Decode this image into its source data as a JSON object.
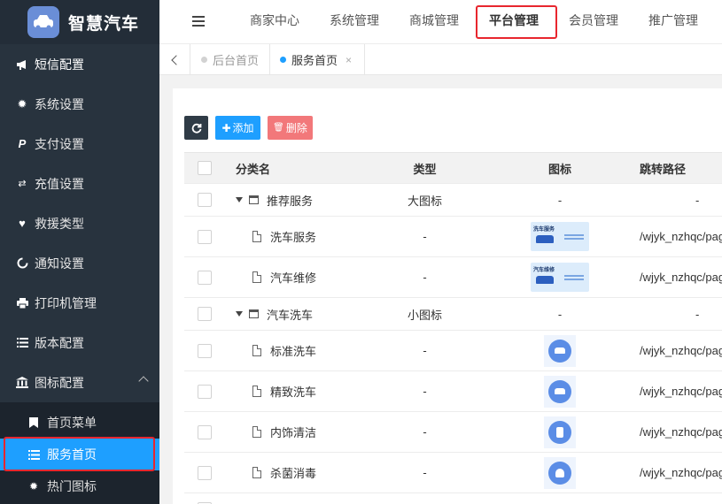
{
  "brand": {
    "title": "智慧汽车",
    "logo_icon": "car-icon"
  },
  "sidebar": {
    "items": [
      {
        "label": "短信配置",
        "icon": "megaphone-icon"
      },
      {
        "label": "系统设置",
        "icon": "gear-icon"
      },
      {
        "label": "支付设置",
        "icon": "paypal-icon"
      },
      {
        "label": "充值设置",
        "icon": "money-transfer-icon"
      },
      {
        "label": "救援类型",
        "icon": "heart-icon"
      },
      {
        "label": "通知设置",
        "icon": "circle-notch-icon"
      },
      {
        "label": "打印机管理",
        "icon": "printer-icon"
      },
      {
        "label": "版本配置",
        "icon": "list-icon"
      },
      {
        "label": "图标配置",
        "icon": "bank-icon",
        "expanded": true
      }
    ],
    "submenu": [
      {
        "label": "首页菜单",
        "icon": "bookmark-icon"
      },
      {
        "label": "服务首页",
        "icon": "list-icon",
        "active": true
      },
      {
        "label": "热门图标",
        "icon": "gear-icon"
      }
    ]
  },
  "topnav": {
    "items": [
      "商家中心",
      "系统管理",
      "商城管理",
      "平台管理",
      "会员管理",
      "推广管理"
    ],
    "active": "平台管理"
  },
  "pagetabs": [
    {
      "label": "后台首页",
      "active": false
    },
    {
      "label": "服务首页",
      "active": true
    }
  ],
  "toolbar": {
    "add_label": "添加",
    "delete_label": "删除"
  },
  "table": {
    "headers": [
      "分类名",
      "类型",
      "图标",
      "跳转路径"
    ],
    "rows": [
      {
        "kind": "category",
        "name": "推荐服务",
        "type": "大图标",
        "icon": "-",
        "path": "-"
      },
      {
        "kind": "item",
        "name": "洗车服务",
        "type": "-",
        "thumb": "big",
        "thumb_text": "洗车服务",
        "path": "/wjyk_nzhqc/pag"
      },
      {
        "kind": "item",
        "name": "汽车维修",
        "type": "-",
        "thumb": "big",
        "thumb_text": "汽车维修",
        "path": "/wjyk_nzhqc/pag"
      },
      {
        "kind": "category",
        "name": "汽车洗车",
        "type": "小图标",
        "icon": "-",
        "path": "-"
      },
      {
        "kind": "item",
        "name": "标准洗车",
        "type": "-",
        "thumb": "small",
        "path": "/wjyk_nzhqc/pag"
      },
      {
        "kind": "item",
        "name": "精致洗车",
        "type": "-",
        "thumb": "small",
        "path": "/wjyk_nzhqc/pag"
      },
      {
        "kind": "item",
        "name": "内饰清洁",
        "type": "-",
        "thumb": "small",
        "path": "/wjyk_nzhqc/pag"
      },
      {
        "kind": "item",
        "name": "杀菌消毒",
        "type": "-",
        "thumb": "small",
        "path": "/wjyk_nzhqc/pag"
      }
    ]
  },
  "colors": {
    "sidebar_bg": "#28333e",
    "accent": "#1e9fff",
    "danger": "#f2787a",
    "highlight": "#e8262e"
  }
}
